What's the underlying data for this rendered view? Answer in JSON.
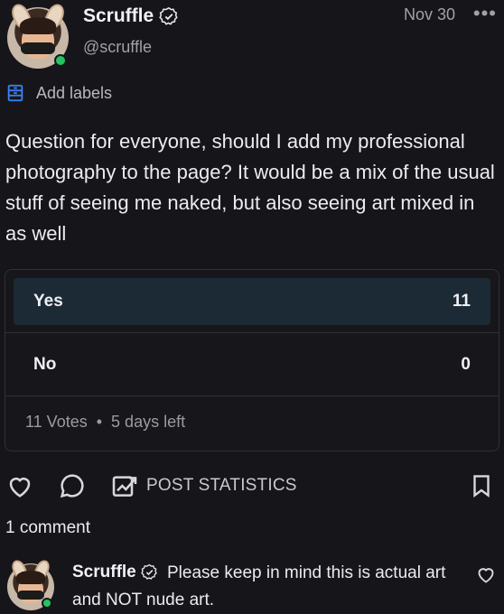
{
  "post": {
    "author_name": "Scruffle",
    "handle": "@scruffle",
    "date": "Nov 30",
    "more_label": "•••",
    "add_labels": "Add labels",
    "text": "Question for everyone, should I add my professional photography to the page? It would be a mix of the usual stuff of seeing me naked, but also seeing art mixed in as well"
  },
  "poll": {
    "options": [
      {
        "label": "Yes",
        "count": "11",
        "fraction": 1.0
      },
      {
        "label": "No",
        "count": "0",
        "fraction": 0.0
      }
    ],
    "votes": "11 Votes",
    "separator": "•",
    "time_left": "5 days left"
  },
  "actions": {
    "stats_label": "POST STATISTICS"
  },
  "comments": {
    "count_label": "1 comment",
    "items": [
      {
        "author": "Scruffle",
        "text": "Please keep in mind this is actual art and NOT nude art."
      }
    ]
  },
  "colors": {
    "background": "#16161a",
    "poll_selected": "#1c2a36",
    "online": "#22c55e",
    "accent": "#3b82f6"
  }
}
